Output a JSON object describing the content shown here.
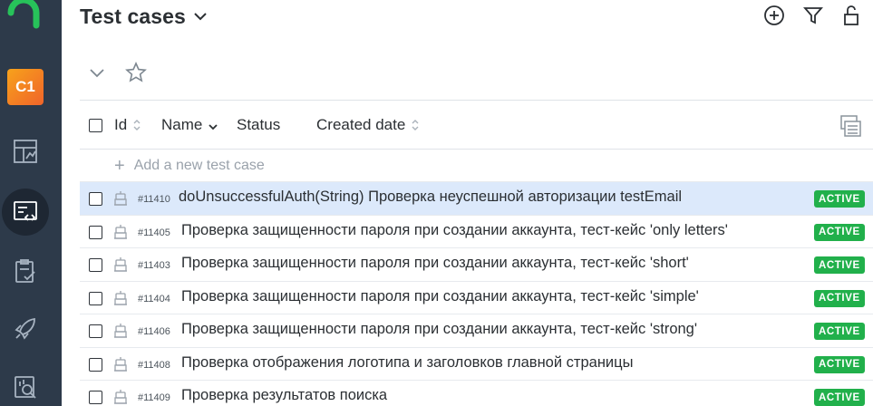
{
  "header": {
    "title": "Test cases"
  },
  "sidebar": {
    "project_badge": "C1"
  },
  "table": {
    "columns": {
      "id": "Id",
      "name": "Name",
      "status": "Status",
      "created_date": "Created date"
    },
    "add_label": "Add a new test case",
    "rows": [
      {
        "id": "#11410",
        "name": "doUnsuccessfulAuth(String) Проверка неуспешной авторизации testEmail",
        "status": "ACTIVE",
        "selected": true
      },
      {
        "id": "#11405",
        "name": "Проверка защищенности пароля при создании аккаунта, тест-кейс 'only letters'",
        "status": "ACTIVE",
        "selected": false
      },
      {
        "id": "#11403",
        "name": "Проверка защищенности пароля при создании аккаунта, тест-кейс 'short'",
        "status": "ACTIVE",
        "selected": false
      },
      {
        "id": "#11404",
        "name": "Проверка защищенности пароля при создании аккаунта, тест-кейс 'simple'",
        "status": "ACTIVE",
        "selected": false
      },
      {
        "id": "#11406",
        "name": "Проверка защищенности пароля при создании аккаунта, тест-кейс 'strong'",
        "status": "ACTIVE",
        "selected": false
      },
      {
        "id": "#11408",
        "name": "Проверка отображения логотипа и заголовков главной страницы",
        "status": "ACTIVE",
        "selected": false
      },
      {
        "id": "#11409",
        "name": "Проверка результатов поиска",
        "status": "ACTIVE",
        "selected": false
      }
    ]
  },
  "colors": {
    "sidebar_bg": "#2d3a4a",
    "accent_green": "#21b04b",
    "selected_row": "#dce9fb",
    "badge_orange": "#f39020"
  },
  "icons": [
    "allure-logo-icon",
    "dashboard-icon",
    "test-cases-icon",
    "launches-icon",
    "jobs-rocket-icon",
    "analytics-icon",
    "add-icon",
    "filter-icon",
    "lock-icon",
    "chevron-down-icon",
    "star-icon",
    "robot-icon",
    "columns-settings-icon"
  ]
}
